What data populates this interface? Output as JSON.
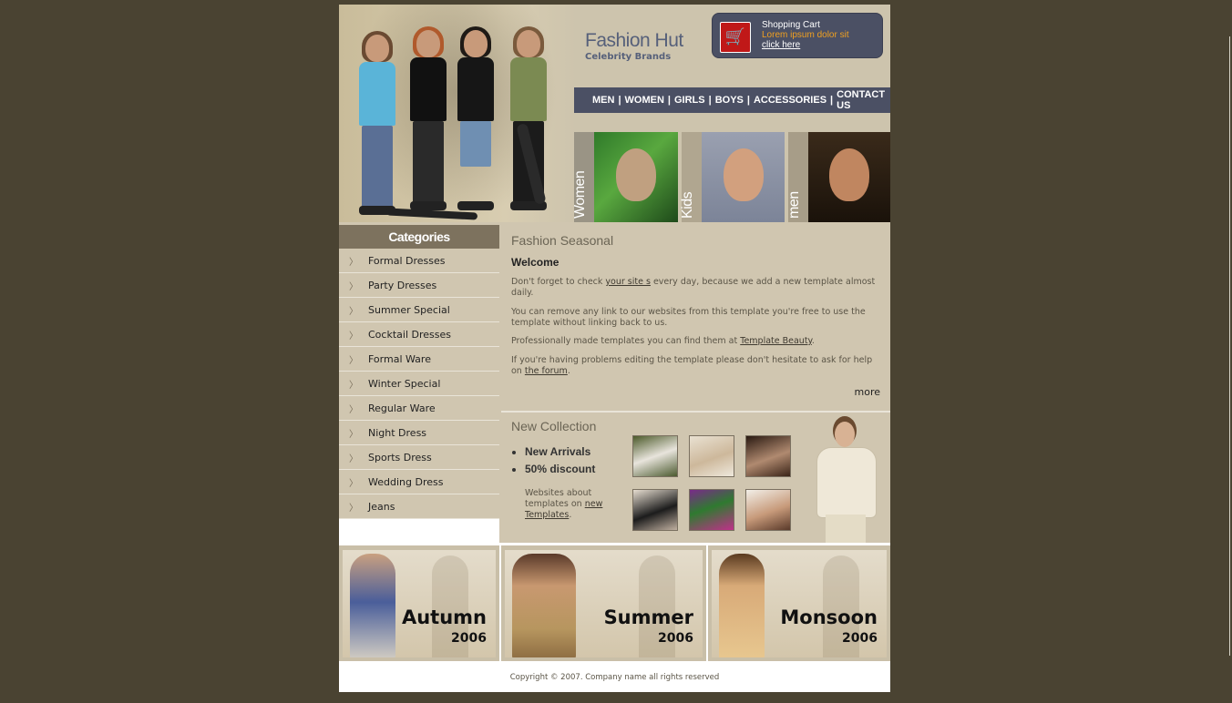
{
  "brand": {
    "title": "Fashion Hut",
    "subtitle": "Celebrity Brands"
  },
  "cart": {
    "icon": "shopping-cart-icon",
    "title": "Shopping Cart",
    "desc": "Lorem ipsum dolor sit",
    "link": "click here"
  },
  "nav": {
    "items": [
      "MEN",
      "WOMEN",
      "GIRLS",
      "BOYS",
      "ACCESSORIES",
      "CONTACT US"
    ],
    "separator": "|"
  },
  "banners": [
    {
      "label": "Women"
    },
    {
      "label": "Kids"
    },
    {
      "label": "men"
    }
  ],
  "sidebar": {
    "title": "Categories",
    "items": [
      "Formal Dresses",
      "Party Dresses",
      "Summer Special",
      "Cocktail Dresses",
      "Formal Ware",
      "Winter Special",
      "Regular Ware",
      "Night Dress",
      "Sports Dress",
      "Wedding Dress",
      "Jeans"
    ]
  },
  "main": {
    "title": "Fashion Seasonal",
    "welcome": "Welcome",
    "p1": {
      "before": "Don't forget to check ",
      "link": "your site s",
      "after": " every day, because we add a new template almost daily."
    },
    "p2": "You can remove any link to our websites from this template you're free to use the template without linking back to us.",
    "p3": {
      "before": "Professionally made templates you can find them at ",
      "link": "Template Beauty",
      "after": "."
    },
    "p4": {
      "before": "If you're having problems editing the template please don't hesitate to ask for help on ",
      "link": "the forum",
      "after": "."
    },
    "more": "more"
  },
  "collection": {
    "title": "New Collection",
    "bullets": [
      "New Arrivals",
      "50% discount"
    ],
    "note": {
      "before": "Websites about templates on ",
      "link": "new Templates",
      "after": "."
    }
  },
  "seasons": [
    {
      "name": "Autumn",
      "year": "2006"
    },
    {
      "name": "Summer",
      "year": "2006"
    },
    {
      "name": "Monsoon",
      "year": "2006"
    }
  ],
  "footer": "Copyright © 2007. Company name all rights reserved",
  "colors": {
    "page_bg": "#4a4332",
    "nav_bg": "#4b5064",
    "content_bg": "#d0c6b0",
    "category_head": "#7d725e",
    "cart_accent": "#f0a020"
  }
}
